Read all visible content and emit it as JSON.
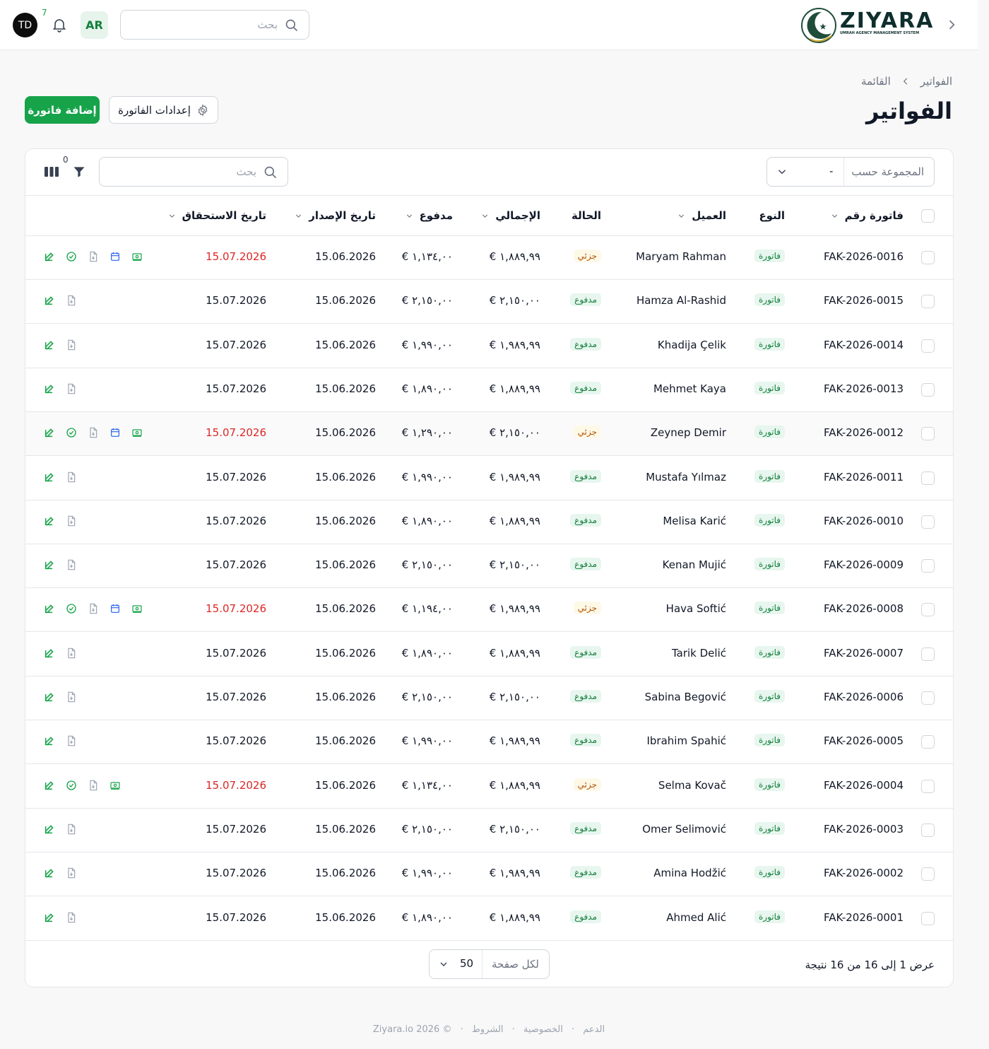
{
  "topbar": {
    "user_initials": "TD",
    "notification_count": "7",
    "language": "AR",
    "search_placeholder": "بحث",
    "logo_name": "ZIYARA",
    "logo_tagline": "UMRAH AGENCY MANAGEMENT SYSTEM"
  },
  "breadcrumb": {
    "current": "القائمة",
    "parent": "الفواتير"
  },
  "page_title": "الفواتير",
  "buttons": {
    "add_invoice": "إضافة فاتورة",
    "invoice_settings": "إعدادات الفاتورة"
  },
  "toolbar": {
    "group_by_label": "المجموعة حسب",
    "group_by_value": "-",
    "search_placeholder": "بحث",
    "filter_count": "0"
  },
  "columns": {
    "invoice_no": "فاتورة رقم",
    "type": "النوع",
    "client": "العميل",
    "status": "الحالة",
    "total": "الإجمالي",
    "paid": "مدفوع",
    "issue_date": "تاريخ الإصدار",
    "due_date": "تاريخ الاستحقاق"
  },
  "colors": {
    "primary": "#16a34a",
    "overdue": "#dc2626",
    "partial_bg": "#fef9e7",
    "paid_bg": "#e7f6ee"
  },
  "rows": [
    {
      "invoice": "FAK-2026-0016",
      "type": "فاتورة",
      "client": "Maryam Rahman",
      "status": "جزئي",
      "status_kind": "partial",
      "total": "€ ١,٨٨٩,٩٩",
      "paid": "€ ١,١٣٤,٠٠",
      "issue": "15.06.2026",
      "due": "15.07.2026",
      "overdue": true,
      "actions": [
        "edit",
        "check",
        "pdf",
        "calendar",
        "money"
      ]
    },
    {
      "invoice": "FAK-2026-0015",
      "type": "فاتورة",
      "client": "Hamza Al-Rashid",
      "status": "مدفوع",
      "status_kind": "paid",
      "total": "€ ٢,١٥٠,٠٠",
      "paid": "€ ٢,١٥٠,٠٠",
      "issue": "15.06.2026",
      "due": "15.07.2026",
      "overdue": false,
      "actions": [
        "edit",
        "pdf"
      ]
    },
    {
      "invoice": "FAK-2026-0014",
      "type": "فاتورة",
      "client": "Khadija Çelik",
      "status": "مدفوع",
      "status_kind": "paid",
      "total": "€ ١,٩٨٩,٩٩",
      "paid": "€ ١,٩٩٠,٠٠",
      "issue": "15.06.2026",
      "due": "15.07.2026",
      "overdue": false,
      "actions": [
        "edit",
        "pdf"
      ]
    },
    {
      "invoice": "FAK-2026-0013",
      "type": "فاتورة",
      "client": "Mehmet Kaya",
      "status": "مدفوع",
      "status_kind": "paid",
      "total": "€ ١,٨٨٩,٩٩",
      "paid": "€ ١,٨٩٠,٠٠",
      "issue": "15.06.2026",
      "due": "15.07.2026",
      "overdue": false,
      "actions": [
        "edit",
        "pdf"
      ]
    },
    {
      "invoice": "FAK-2026-0012",
      "type": "فاتورة",
      "client": "Zeynep Demir",
      "status": "جزئي",
      "status_kind": "partial",
      "total": "€ ٢,١٥٠,٠٠",
      "paid": "€ ١,٢٩٠,٠٠",
      "issue": "15.06.2026",
      "due": "15.07.2026",
      "overdue": true,
      "actions": [
        "edit",
        "check",
        "pdf",
        "calendar",
        "money"
      ]
    },
    {
      "invoice": "FAK-2026-0011",
      "type": "فاتورة",
      "client": "Mustafa Yılmaz",
      "status": "مدفوع",
      "status_kind": "paid",
      "total": "€ ١,٩٨٩,٩٩",
      "paid": "€ ١,٩٩٠,٠٠",
      "issue": "15.06.2026",
      "due": "15.07.2026",
      "overdue": false,
      "actions": [
        "edit",
        "pdf"
      ]
    },
    {
      "invoice": "FAK-2026-0010",
      "type": "فاتورة",
      "client": "Melisa Karić",
      "status": "مدفوع",
      "status_kind": "paid",
      "total": "€ ١,٨٨٩,٩٩",
      "paid": "€ ١,٨٩٠,٠٠",
      "issue": "15.06.2026",
      "due": "15.07.2026",
      "overdue": false,
      "actions": [
        "edit",
        "pdf"
      ]
    },
    {
      "invoice": "FAK-2026-0009",
      "type": "فاتورة",
      "client": "Kenan Mujić",
      "status": "مدفوع",
      "status_kind": "paid",
      "total": "€ ٢,١٥٠,٠٠",
      "paid": "€ ٢,١٥٠,٠٠",
      "issue": "15.06.2026",
      "due": "15.07.2026",
      "overdue": false,
      "actions": [
        "edit",
        "pdf"
      ]
    },
    {
      "invoice": "FAK-2026-0008",
      "type": "فاتورة",
      "client": "Hava Softić",
      "status": "جزئي",
      "status_kind": "partial",
      "total": "€ ١,٩٨٩,٩٩",
      "paid": "€ ١,١٩٤,٠٠",
      "issue": "15.06.2026",
      "due": "15.07.2026",
      "overdue": true,
      "actions": [
        "edit",
        "check",
        "pdf",
        "calendar",
        "money"
      ]
    },
    {
      "invoice": "FAK-2026-0007",
      "type": "فاتورة",
      "client": "Tarik Delić",
      "status": "مدفوع",
      "status_kind": "paid",
      "total": "€ ١,٨٨٩,٩٩",
      "paid": "€ ١,٨٩٠,٠٠",
      "issue": "15.06.2026",
      "due": "15.07.2026",
      "overdue": false,
      "actions": [
        "edit",
        "pdf"
      ]
    },
    {
      "invoice": "FAK-2026-0006",
      "type": "فاتورة",
      "client": "Sabina Begović",
      "status": "مدفوع",
      "status_kind": "paid",
      "total": "€ ٢,١٥٠,٠٠",
      "paid": "€ ٢,١٥٠,٠٠",
      "issue": "15.06.2026",
      "due": "15.07.2026",
      "overdue": false,
      "actions": [
        "edit",
        "pdf"
      ]
    },
    {
      "invoice": "FAK-2026-0005",
      "type": "فاتورة",
      "client": "Ibrahim Spahić",
      "status": "مدفوع",
      "status_kind": "paid",
      "total": "€ ١,٩٨٩,٩٩",
      "paid": "€ ١,٩٩٠,٠٠",
      "issue": "15.06.2026",
      "due": "15.07.2026",
      "overdue": false,
      "actions": [
        "edit",
        "pdf"
      ]
    },
    {
      "invoice": "FAK-2026-0004",
      "type": "فاتورة",
      "client": "Selma Kovač",
      "status": "جزئي",
      "status_kind": "partial",
      "total": "€ ١,٨٨٩,٩٩",
      "paid": "€ ١,١٣٤,٠٠",
      "issue": "15.06.2026",
      "due": "15.07.2026",
      "overdue": true,
      "actions": [
        "edit",
        "check",
        "pdf",
        "money"
      ]
    },
    {
      "invoice": "FAK-2026-0003",
      "type": "فاتورة",
      "client": "Omer Selimović",
      "status": "مدفوع",
      "status_kind": "paid",
      "total": "€ ٢,١٥٠,٠٠",
      "paid": "€ ٢,١٥٠,٠٠",
      "issue": "15.06.2026",
      "due": "15.07.2026",
      "overdue": false,
      "actions": [
        "edit",
        "pdf"
      ]
    },
    {
      "invoice": "FAK-2026-0002",
      "type": "فاتورة",
      "client": "Amina Hodžić",
      "status": "مدفوع",
      "status_kind": "paid",
      "total": "€ ١,٩٨٩,٩٩",
      "paid": "€ ١,٩٩٠,٠٠",
      "issue": "15.06.2026",
      "due": "15.07.2026",
      "overdue": false,
      "actions": [
        "edit",
        "pdf"
      ]
    },
    {
      "invoice": "FAK-2026-0001",
      "type": "فاتورة",
      "client": "Ahmed Alić",
      "status": "مدفوع",
      "status_kind": "paid",
      "total": "€ ١,٨٨٩,٩٩",
      "paid": "€ ١,٨٩٠,٠٠",
      "issue": "15.06.2026",
      "due": "15.07.2026",
      "overdue": false,
      "actions": [
        "edit",
        "pdf"
      ]
    }
  ],
  "pagination": {
    "showing_text": "عرض 1 إلى 16 من 16 نتيجة",
    "per_page_label": "لكل صفحة",
    "per_page_value": "50"
  },
  "footer": {
    "copyright": "© 2026 Ziyara.io",
    "terms": "الشروط",
    "privacy": "الخصوصية",
    "support": "الدعم"
  }
}
